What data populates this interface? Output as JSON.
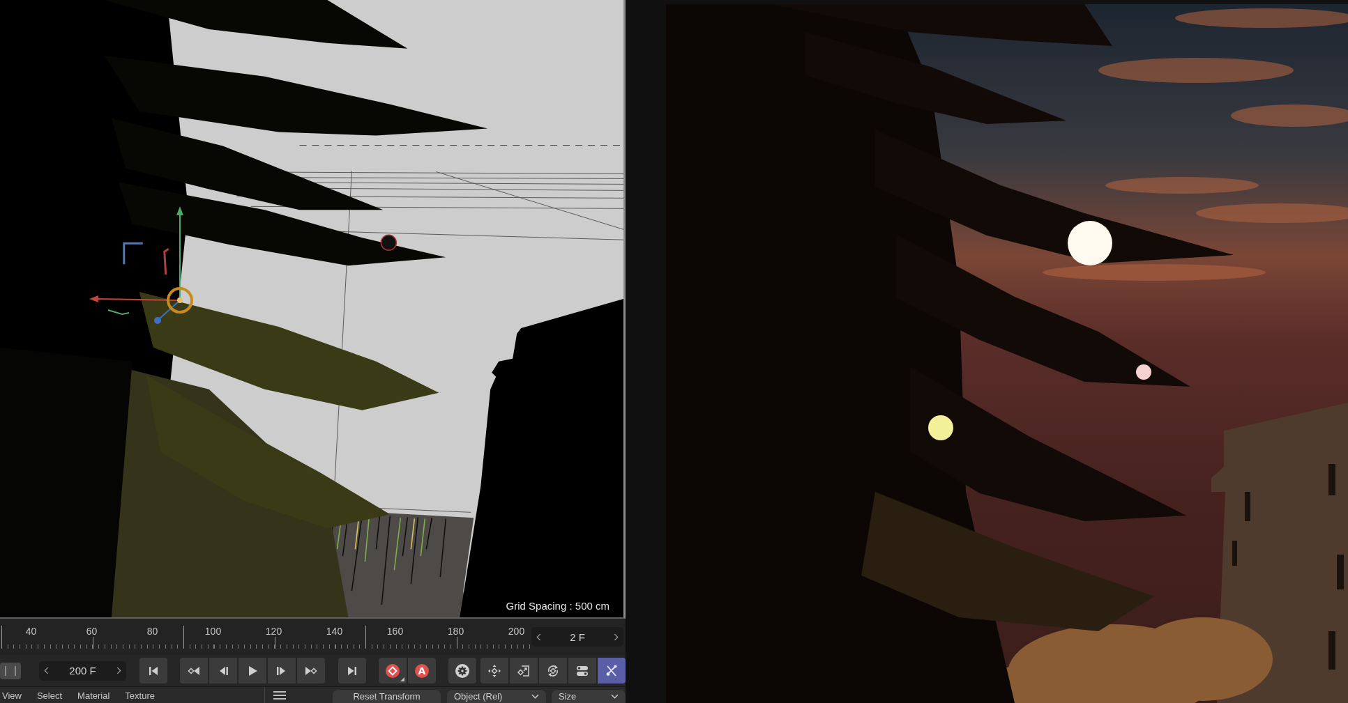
{
  "viewport": {
    "grid_spacing": "Grid Spacing : 500 cm"
  },
  "timeline": {
    "tick_labels": [
      "40",
      "60",
      "80",
      "100",
      "120",
      "140",
      "160",
      "180",
      "200"
    ],
    "current_frame": "2 F"
  },
  "transport": {
    "end_frame": "200 F",
    "autokey_label": "A",
    "key_tools": [
      {
        "kind": "position",
        "selected": false
      },
      {
        "kind": "scale",
        "selected": false
      },
      {
        "kind": "rotation",
        "selected": false
      },
      {
        "kind": "parameter",
        "selected": false
      },
      {
        "kind": "point-level",
        "selected": true
      }
    ]
  },
  "menu_bar": {
    "items": [
      "View",
      "Select",
      "Material",
      "Texture"
    ]
  },
  "coordinates_bar": {
    "reset_button": "Reset Transform",
    "mode_dropdown": "Object (Rel)",
    "size_dropdown": "Size"
  }
}
